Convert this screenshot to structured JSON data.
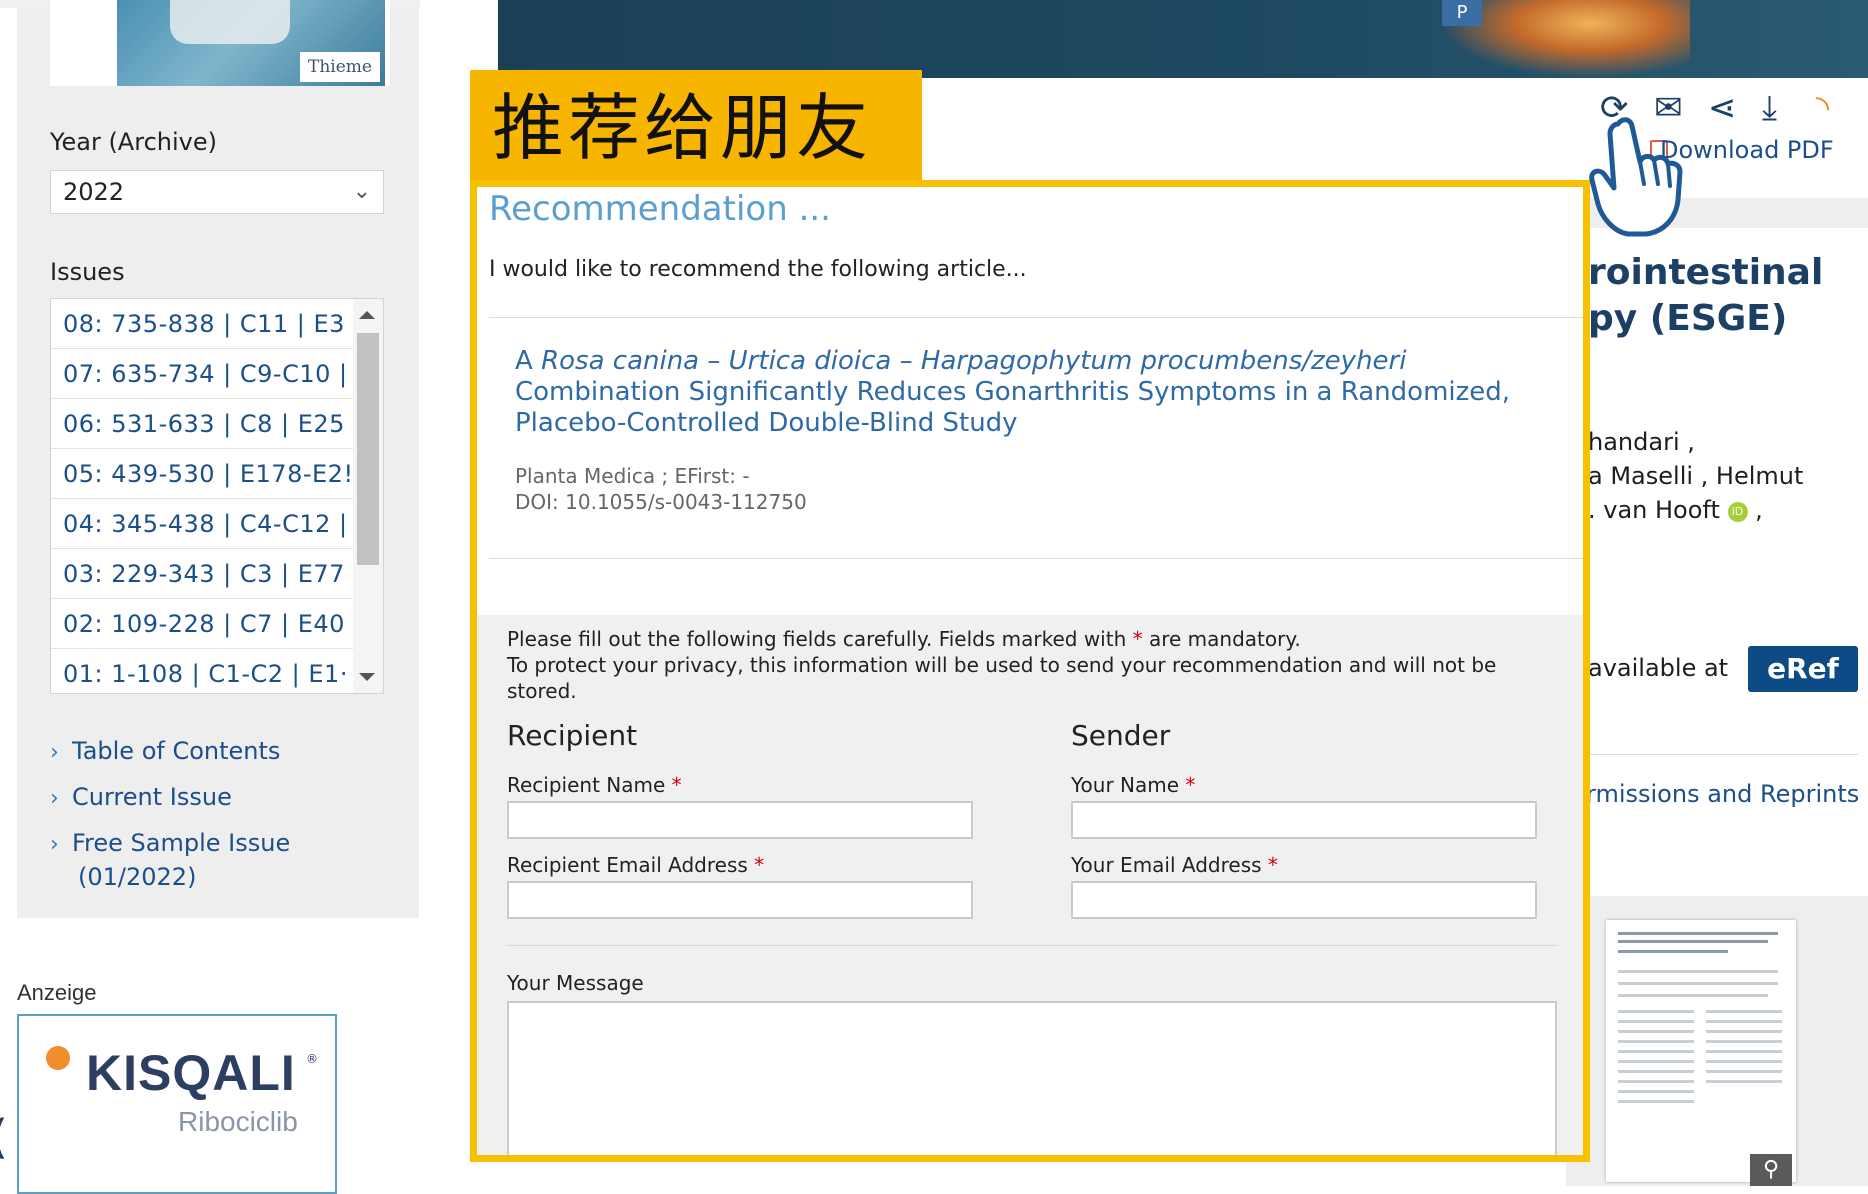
{
  "sidebar": {
    "cover_brand": "Thieme",
    "year_label": "Year (Archive)",
    "year_value": "2022",
    "issues_label": "Issues",
    "issues": [
      "08: 735-838 | C11 | E3",
      "07: 635-734 | C9-C10 |",
      "06: 531-633 | C8 | E25",
      "05: 439-530 | E178-E2!",
      "04: 345-438 | C4-C12 |",
      "03: 229-343 | C3 | E77",
      "02: 109-228 | C7 | E40",
      "01: 1-108 | C1-C2 | E1·"
    ],
    "links": [
      "Table of Contents",
      "Current Issue",
      "Free Sample Issue",
      "(01/2022)"
    ]
  },
  "ad": {
    "label": "Anzeige",
    "brand": "KISQALI",
    "registered": "®",
    "sub": "Ribociclib"
  },
  "annotation": {
    "label": "推荐给朋友"
  },
  "toolbar": {
    "download_pdf": "Download PDF",
    "icons": [
      "share-link-icon",
      "email-icon",
      "share-icon",
      "download-icon",
      "rss-icon"
    ]
  },
  "article_bg": {
    "title_line_1": "rointestinal",
    "title_line_2": "py (ESGE)",
    "authors": [
      "handari ,",
      "a Maselli , Helmut",
      ". van Hooft"
    ],
    "author_tail": " ,",
    "orcid_badge": "iD",
    "available_text": "available at",
    "eref_label": "eRef",
    "permissions": "rmissions and Reprints"
  },
  "modal": {
    "title": "Recommendation ...",
    "intro": "I would like to recommend the following article...",
    "article_title_prefix": "A ",
    "article_title_italic": "Rosa canina – Urtica dioica – Harpagophytum procumbens/zeyheri",
    "article_title_rest": "Combination Significantly Reduces Gonarthritis Symptoms in a Randomized, Placebo-Controlled Double-Blind Study",
    "journal_line": "Planta Medica ; EFirst: -",
    "doi_line": "DOI: 10.1055/s-0043-112750",
    "form_note_1_pre": "Please fill out the following fields carefully. Fields marked with",
    "form_note_1_post": "are mandatory.",
    "form_note_2": "To protect your privacy, this information will be used to send your recommendation and will not be",
    "form_note_3": "stored.",
    "required_mark": "*",
    "recipient_title": "Recipient",
    "sender_title": "Sender",
    "recipient_name_label": "Recipient Name",
    "recipient_email_label": "Recipient Email Address",
    "your_name_label": "Your Name",
    "your_email_label": "Your Email Address",
    "message_label": "Your Message"
  },
  "colors": {
    "accent_yellow": "#f7b500",
    "link_blue": "#1c4f8a",
    "eref_blue": "#0d4a86",
    "required_red": "#d0021b"
  }
}
